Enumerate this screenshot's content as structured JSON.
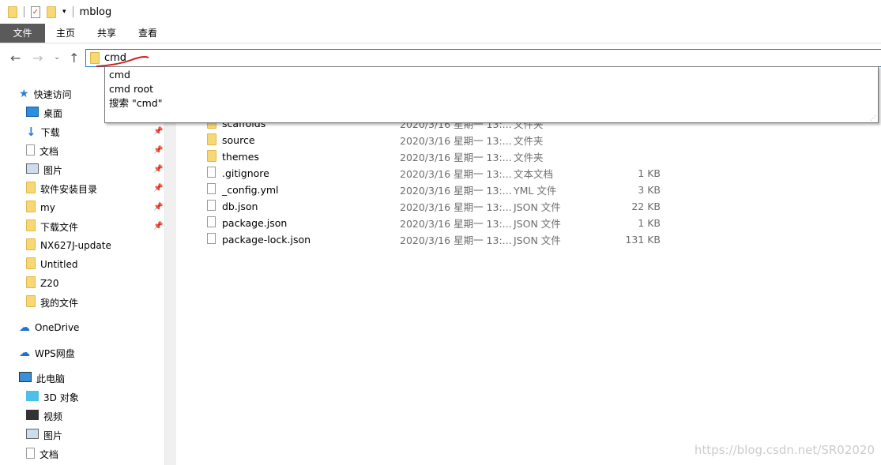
{
  "window": {
    "title": "mblog"
  },
  "ribbon": {
    "tabs": [
      "文件",
      "主页",
      "共享",
      "查看"
    ]
  },
  "address": {
    "value": "cmd"
  },
  "suggestions": [
    "cmd",
    "cmd root",
    "搜索 \"cmd\""
  ],
  "sidebar": {
    "items": [
      {
        "label": "快速访问",
        "icon": "star-icon",
        "indent": 0,
        "pinned": false
      },
      {
        "label": "桌面",
        "icon": "desktop-icon",
        "indent": 1,
        "pinned": false
      },
      {
        "label": "下载",
        "icon": "download-icon",
        "indent": 1,
        "pinned": true
      },
      {
        "label": "文档",
        "icon": "document-icon",
        "indent": 1,
        "pinned": true
      },
      {
        "label": "图片",
        "icon": "picture-icon",
        "indent": 1,
        "pinned": true
      },
      {
        "label": "软件安装目录",
        "icon": "folder-icon",
        "indent": 1,
        "pinned": true
      },
      {
        "label": "my",
        "icon": "folder-icon",
        "indent": 1,
        "pinned": true
      },
      {
        "label": "下载文件",
        "icon": "folder-icon",
        "indent": 1,
        "pinned": true
      },
      {
        "label": "NX627J-update",
        "icon": "folder-icon",
        "indent": 1,
        "pinned": false
      },
      {
        "label": "Untitled",
        "icon": "folder-icon",
        "indent": 1,
        "pinned": false
      },
      {
        "label": "Z20",
        "icon": "folder-icon",
        "indent": 1,
        "pinned": false
      },
      {
        "label": "我的文件",
        "icon": "folder-icon",
        "indent": 1,
        "pinned": false
      },
      {
        "label": "OneDrive",
        "icon": "cloud-icon",
        "indent": 0,
        "pinned": false,
        "gap": true
      },
      {
        "label": "WPS网盘",
        "icon": "cloud-icon",
        "indent": 0,
        "pinned": false,
        "gap": true
      },
      {
        "label": "此电脑",
        "icon": "computer-icon",
        "indent": 0,
        "pinned": false,
        "gap": true
      },
      {
        "label": "3D 对象",
        "icon": "cube-icon",
        "indent": 1,
        "pinned": false
      },
      {
        "label": "视频",
        "icon": "video-icon",
        "indent": 1,
        "pinned": false
      },
      {
        "label": "图片",
        "icon": "picture-icon",
        "indent": 1,
        "pinned": false
      },
      {
        "label": "文档",
        "icon": "document-icon",
        "indent": 1,
        "pinned": false
      }
    ]
  },
  "files": [
    {
      "name": "scaffolds",
      "date": "2020/3/16 星期一 13:...",
      "type": "文件夹",
      "size": "",
      "kind": "folder"
    },
    {
      "name": "source",
      "date": "2020/3/16 星期一 13:...",
      "type": "文件夹",
      "size": "",
      "kind": "folder"
    },
    {
      "name": "themes",
      "date": "2020/3/16 星期一 13:...",
      "type": "文件夹",
      "size": "",
      "kind": "folder"
    },
    {
      "name": ".gitignore",
      "date": "2020/3/16 星期一 13:...",
      "type": "文本文档",
      "size": "1 KB",
      "kind": "file"
    },
    {
      "name": "_config.yml",
      "date": "2020/3/16 星期一 13:...",
      "type": "YML 文件",
      "size": "3 KB",
      "kind": "file"
    },
    {
      "name": "db.json",
      "date": "2020/3/16 星期一 13:...",
      "type": "JSON 文件",
      "size": "22 KB",
      "kind": "file"
    },
    {
      "name": "package.json",
      "date": "2020/3/16 星期一 13:...",
      "type": "JSON 文件",
      "size": "1 KB",
      "kind": "file"
    },
    {
      "name": "package-lock.json",
      "date": "2020/3/16 星期一 13:...",
      "type": "JSON 文件",
      "size": "131 KB",
      "kind": "file"
    }
  ],
  "watermark": "https://blog.csdn.net/SR02020"
}
